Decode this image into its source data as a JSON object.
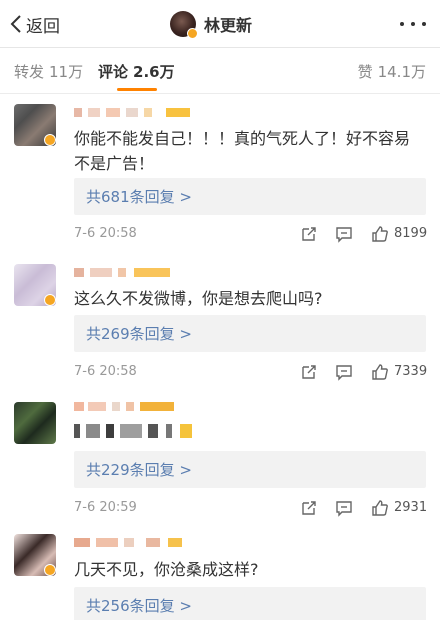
{
  "header": {
    "back_label": "返回",
    "title": "林更新"
  },
  "tabs": {
    "repost_label": "转发",
    "repost_count": "11万",
    "comment_label": "评论",
    "comment_count": "2.6万",
    "like_label": "赞",
    "like_count": "14.1万",
    "active": "comment",
    "accent": "#ff8200"
  },
  "comments": [
    {
      "text": "你能不能发自己！！！真的气死人了！好不容易不是广告！",
      "replies": "共681条回复 >",
      "time": "7-6 20:58",
      "likes": "8199"
    },
    {
      "text": "这么久不发微博，你是想去爬山吗?",
      "replies": "共269条回复 >",
      "time": "7-6 20:58",
      "likes": "7339"
    },
    {
      "text": "",
      "replies": "共229条回复 >",
      "time": "7-6 20:59",
      "likes": "2931"
    },
    {
      "text": "几天不见，你沧桑成这样?",
      "replies": "共256条回复 >"
    }
  ],
  "icons": {
    "back": "chevron-left-icon",
    "more": "more-dots-icon",
    "share": "share-icon",
    "reply": "comment-icon",
    "like": "thumbs-up-icon",
    "verified": "verified-badge-icon"
  },
  "colors": {
    "link": "#5b7eb0",
    "reply_box_bg": "#f2f2f2",
    "muted": "#999999",
    "verified": "#f5a623"
  }
}
